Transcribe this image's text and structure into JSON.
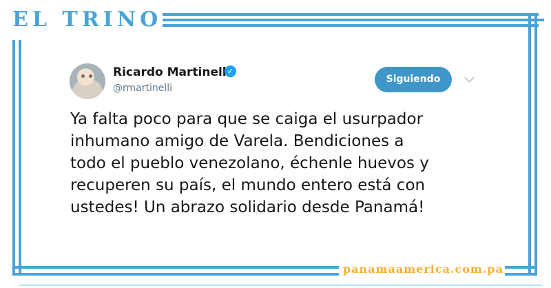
{
  "header": {
    "brand_title": "EL TRINO"
  },
  "tweet": {
    "author_name": "Ricardo Martinelli",
    "author_handle": "@rmartinelli",
    "verified": true,
    "follow_button_label": "Siguiendo",
    "text_lines": [
      "Ya falta poco para que se caiga el usurpador",
      "inhumano amigo de Varela. Bendiciones a",
      "todo el pueblo venezolano, échenle huevos y",
      "recuperen su país, el mundo entero está con",
      "ustedes! Un abrazo solidario desde Panamá!"
    ]
  },
  "footer": {
    "site_url": "panamaamerica.com.pa"
  },
  "colors": {
    "frame": "#4aa3d8",
    "follow_button": "#3f97c9",
    "url_accent": "#f2b233",
    "verified_badge": "#1da1f2"
  }
}
